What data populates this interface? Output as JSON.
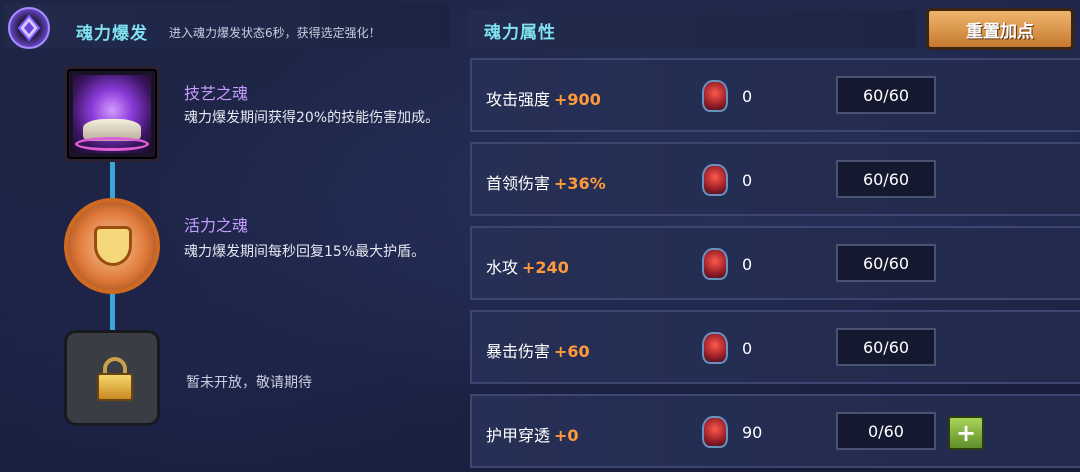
{
  "left": {
    "title": "魂力爆发",
    "description": "进入魂力爆发状态6秒，获得选定强化！",
    "souls": [
      {
        "name": "技艺之魂",
        "desc": "魂力爆发期间获得20%的技能伤害加成。",
        "icon": "purple-flame-book-icon"
      },
      {
        "name": "活力之魂",
        "desc": "魂力爆发期间每秒回复15%最大护盾。",
        "icon": "orange-shield-icon"
      }
    ],
    "locked_text": "暂未开放，敬请期待"
  },
  "right": {
    "title": "魂力属性",
    "reset_label": "重置加点",
    "attributes": [
      {
        "name": "攻击强度",
        "bonus": "+900",
        "gems": "0",
        "level": "60/60"
      },
      {
        "name": "首领伤害",
        "bonus": "+36%",
        "gems": "0",
        "level": "60/60"
      },
      {
        "name": "水攻",
        "bonus": "+240",
        "gems": "0",
        "level": "60/60"
      },
      {
        "name": "暴击伤害",
        "bonus": "+60",
        "gems": "0",
        "level": "60/60"
      },
      {
        "name": "护甲穿透",
        "bonus": "+0",
        "gems": "90",
        "level": "0/60",
        "plus": "+"
      }
    ]
  },
  "colors": {
    "title_cyan": "#7fe0f0",
    "soul_name_purple": "#c79cff",
    "bonus_orange": "#ff9a3c",
    "button_orange": "#e09a4c",
    "plus_green": "#8bbf45"
  }
}
